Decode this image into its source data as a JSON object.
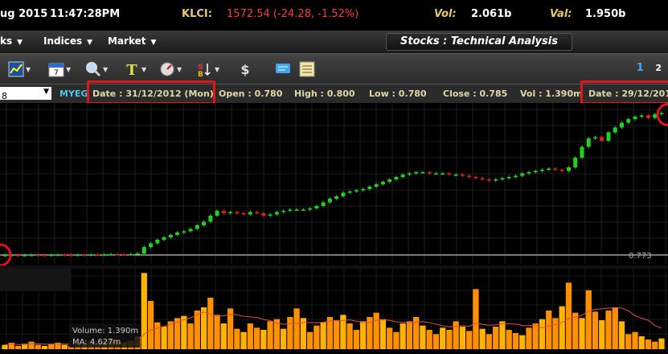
{
  "header": {
    "date": "ug 2015",
    "time": "11:47:28PM",
    "index_name": "KLCI:",
    "index_value": "1572.54 (-24.28, -1.52%)",
    "vol_label": "Vol:",
    "vol_value": "2.061b",
    "val_label": "Val:",
    "val_value": "1.950b"
  },
  "menu": {
    "items": [
      {
        "label": "ks"
      },
      {
        "label": "Indices"
      },
      {
        "label": "Market"
      }
    ],
    "page_title": "Stocks : Technical Analysis"
  },
  "toolbar": {
    "icons": [
      "chart-type-icon",
      "calendar-icon",
      "zoom-icon",
      "text-tool-icon",
      "gauge-icon",
      "buy-sell-icon",
      "dollar-icon",
      "comment-icon",
      "table-icon"
    ],
    "pages": [
      "1",
      "2"
    ]
  },
  "infobar": {
    "symbol_select": "8",
    "symbol": "MYEG",
    "date_label": "Date : 31/12/2012 (Mon)",
    "open": "Open : 0.780",
    "high": "High : 0.800",
    "low": "Low : 0.780",
    "close": "Close : 0.785",
    "vol": "Vol : 1.390m",
    "date2": "Date : 29/12/201"
  },
  "chart_data": {
    "type": "candlestick+volume",
    "price_line_label": "0.773",
    "volume_label": "Volume: 1.390m",
    "ma_label": "MA: 4.627m",
    "price": [
      0.773,
      0.774,
      0.772,
      0.773,
      0.775,
      0.774,
      0.773,
      0.775,
      0.776,
      0.775,
      0.774,
      0.776,
      0.775,
      0.777,
      0.776,
      0.778,
      0.78,
      0.779,
      0.778,
      0.78,
      0.786,
      0.84,
      0.87,
      0.9,
      0.92,
      0.94,
      0.96,
      0.97,
      0.99,
      1.02,
      1.05,
      1.1,
      1.14,
      1.12,
      1.13,
      1.12,
      1.11,
      1.13,
      1.12,
      1.1,
      1.11,
      1.13,
      1.14,
      1.15,
      1.15,
      1.15,
      1.16,
      1.18,
      1.21,
      1.24,
      1.26,
      1.29,
      1.3,
      1.31,
      1.32,
      1.34,
      1.36,
      1.38,
      1.4,
      1.42,
      1.44,
      1.45,
      1.46,
      1.46,
      1.45,
      1.45,
      1.45,
      1.44,
      1.44,
      1.43,
      1.42,
      1.41,
      1.4,
      1.39,
      1.4,
      1.41,
      1.42,
      1.43,
      1.45,
      1.46,
      1.47,
      1.48,
      1.49,
      1.48,
      1.47,
      1.5,
      1.58,
      1.67,
      1.74,
      1.75,
      1.72,
      1.79,
      1.83,
      1.87,
      1.9,
      1.92,
      1.93,
      1.91,
      1.94,
      1.95
    ],
    "volume": [
      0.4,
      0.6,
      0.3,
      0.5,
      0.7,
      0.4,
      0.3,
      0.5,
      0.6,
      0.4,
      0.3,
      0.5,
      0.6,
      0.7,
      0.5,
      0.8,
      1.0,
      0.7,
      0.6,
      0.8,
      1.2,
      7.1,
      4.5,
      2.5,
      2.1,
      2.6,
      2.9,
      3.1,
      2.4,
      3.6,
      3.9,
      4.8,
      3.2,
      2.4,
      3.8,
      1.9,
      1.6,
      2.4,
      2.0,
      1.8,
      2.6,
      2.8,
      1.9,
      3.0,
      3.8,
      2.9,
      1.6,
      2.2,
      2.5,
      3.0,
      2.7,
      3.2,
      2.4,
      1.8,
      2.6,
      3.0,
      3.4,
      2.8,
      2.0,
      1.6,
      2.4,
      2.6,
      3.0,
      2.2,
      1.8,
      1.4,
      2.0,
      1.8,
      2.6,
      2.1,
      1.7,
      5.6,
      1.9,
      1.4,
      2.1,
      2.6,
      1.8,
      1.5,
      1.3,
      2.0,
      2.4,
      2.8,
      3.6,
      2.9,
      4.0,
      6.2,
      3.4,
      2.9,
      5.5,
      3.5,
      2.7,
      3.6,
      3.9,
      2.6,
      1.4,
      1.6,
      1.2,
      0.9,
      0.7,
      1.0
    ]
  }
}
